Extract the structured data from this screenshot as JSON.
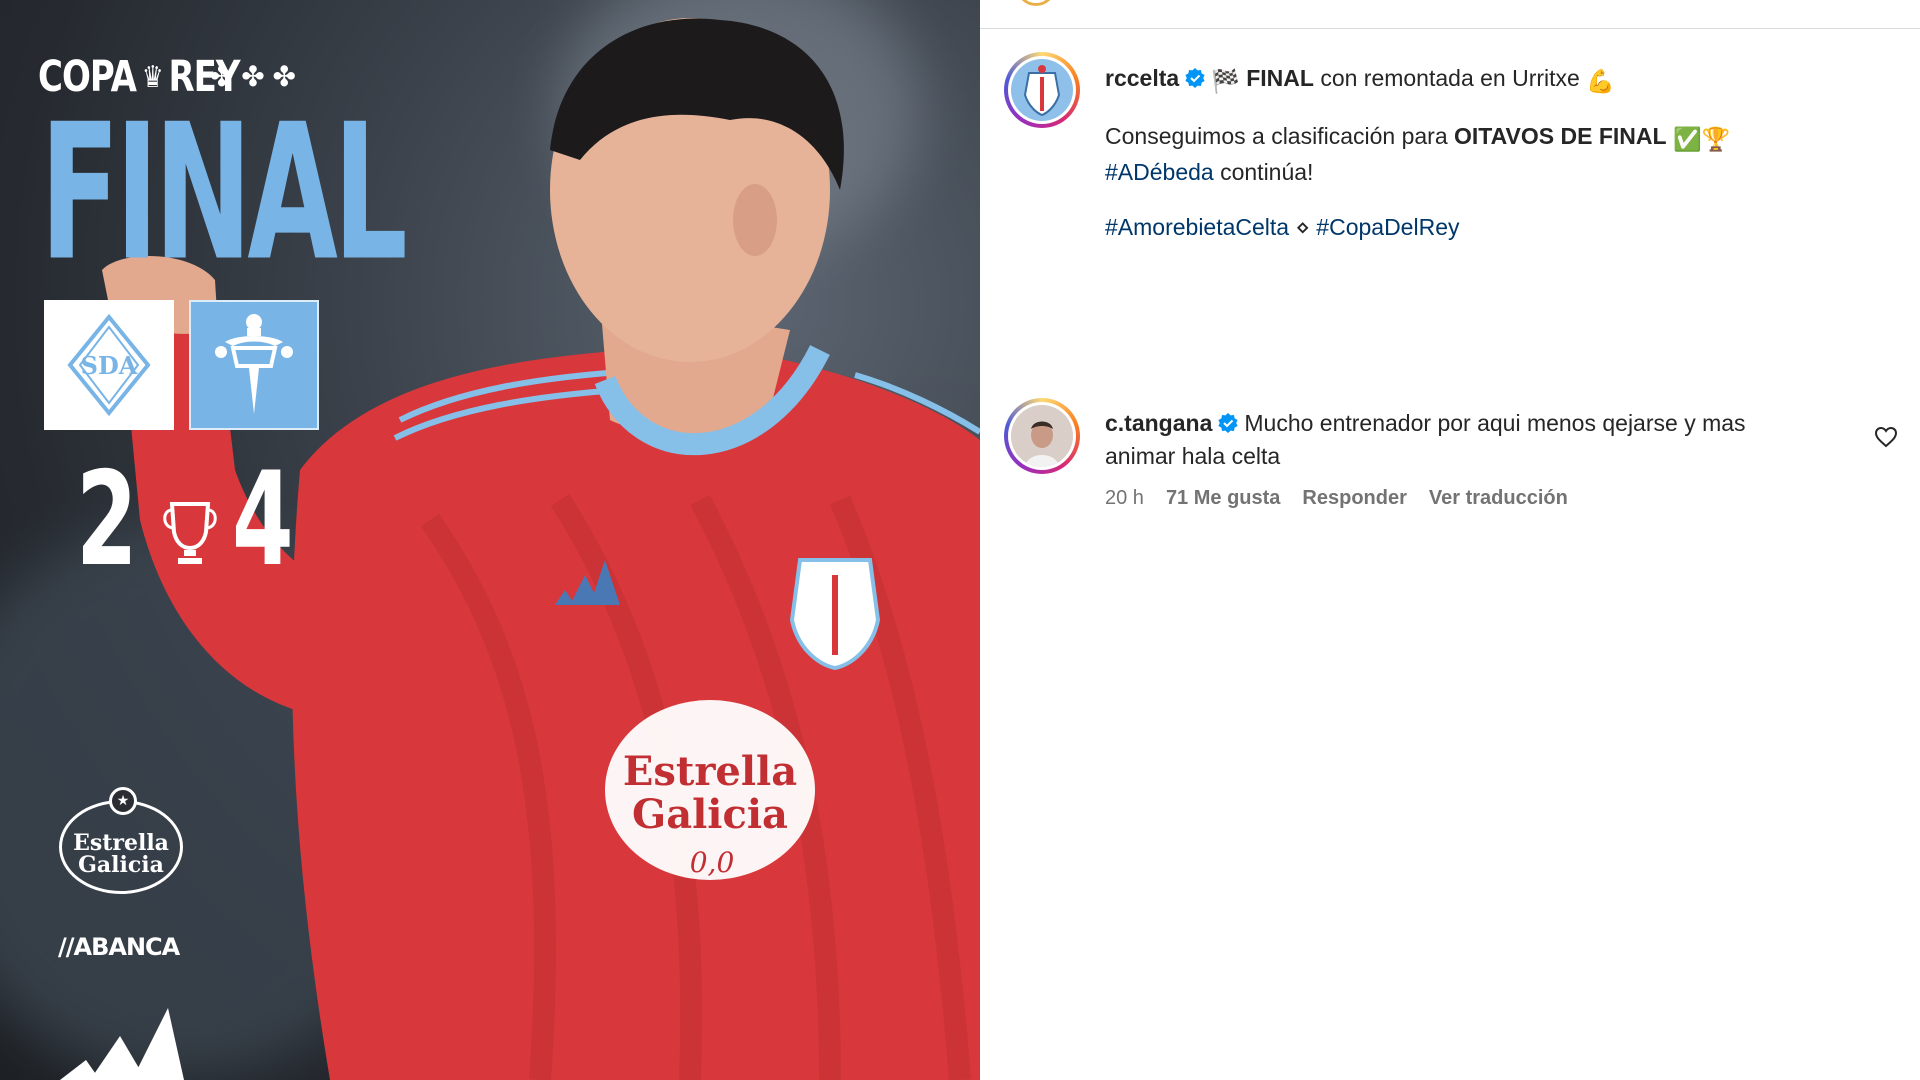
{
  "post_image": {
    "competition_logo_text": "COPA",
    "competition_logo_text_2": "REY",
    "fleurs": "✤ ✤ ✤",
    "headline": "FINAL",
    "home_crest_text": "SDA",
    "score_home": "2",
    "score_away": "4",
    "sponsor_1_line_1": "Estrella",
    "sponsor_1_line_2": "Galicia",
    "sponsor_2": "//ABANCA",
    "shirt_sponsor_line_1": "Estrella",
    "shirt_sponsor_line_2": "Galicia",
    "shirt_sponsor_line_3": "0,0",
    "colors": {
      "sky_blue": "#78b4e6",
      "shirt_red": "#d8383b"
    }
  },
  "caption": {
    "username": "rccelta",
    "flag_emoji": "🏁",
    "title_bold": "FINAL",
    "title_rest": "con remontada en Urritxe",
    "muscle_emoji": "💪",
    "line2_prefix": "Conseguimos a clasificación para",
    "line2_bold": "OITAVOS DE FINAL",
    "check_emoji": "✅",
    "trophy_emoji": "🏆",
    "hashtag_adebeda": "#ADébeda",
    "continua": "continúa!",
    "hashtag_1": "#AmorebietaCelta",
    "separator": "⋄",
    "hashtag_2": "#CopaDelRey"
  },
  "comment": {
    "username": "c.tangana",
    "text_line_1": "Mucho entrenador por aqui menos qejarse y mas",
    "text_line_2": "animar hala celta",
    "time": "20 h",
    "likes": "71 Me gusta",
    "reply": "Responder",
    "translate": "Ver traducción"
  },
  "icons": {
    "verified": "verified-badge-icon",
    "heart": "heart-outline-icon"
  }
}
